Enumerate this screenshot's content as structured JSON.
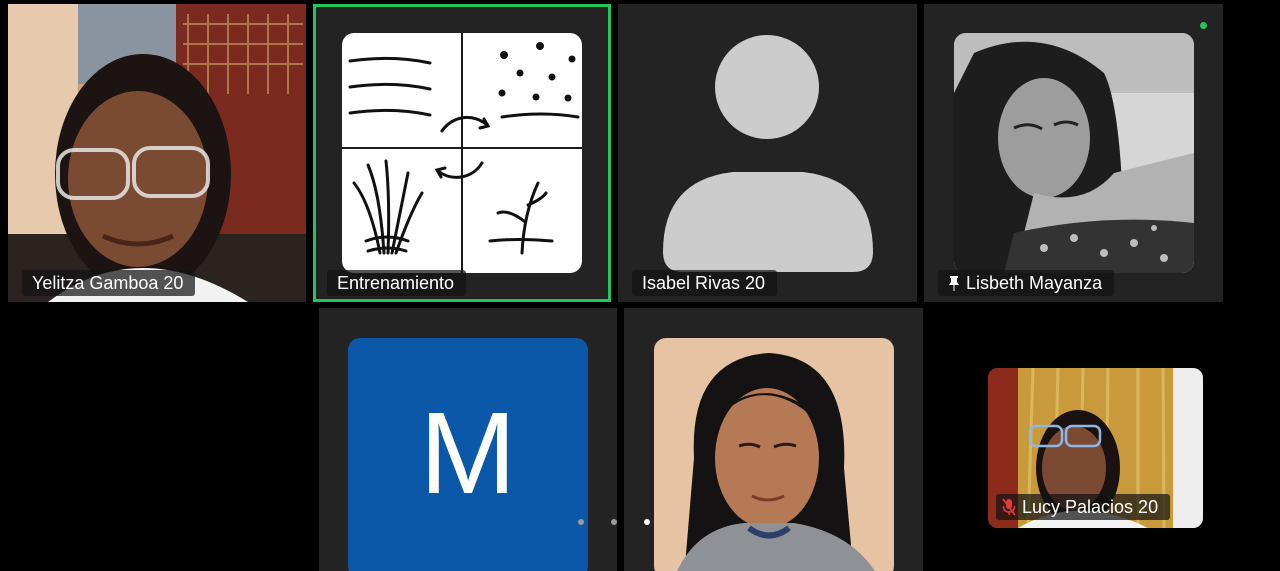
{
  "participants": [
    {
      "name": "Yelitza Gamboa 20",
      "pinned": false,
      "muted": false,
      "type": "video"
    },
    {
      "name": "Entrenamiento",
      "pinned": false,
      "muted": false,
      "type": "image",
      "active_speaker": true
    },
    {
      "name": "Isabel Rivas 20",
      "pinned": false,
      "muted": false,
      "type": "placeholder"
    },
    {
      "name": "Lisbeth Mayanza",
      "pinned": true,
      "muted": false,
      "type": "photo"
    },
    {
      "name": "",
      "initial": "M",
      "type": "initial"
    },
    {
      "name": "",
      "type": "photo"
    },
    {
      "name": "Lucy Palacios 20",
      "pinned": false,
      "muted": true,
      "type": "self-preview"
    }
  ],
  "pagination": {
    "pages": 3,
    "current": 3
  },
  "colors": {
    "active_speaker_outline": "#22c55e",
    "tile_background": "#232323",
    "initial_avatar_bg": "#0b57a8",
    "mute_icon": "#e53935",
    "status_dot": "#22c55e"
  }
}
